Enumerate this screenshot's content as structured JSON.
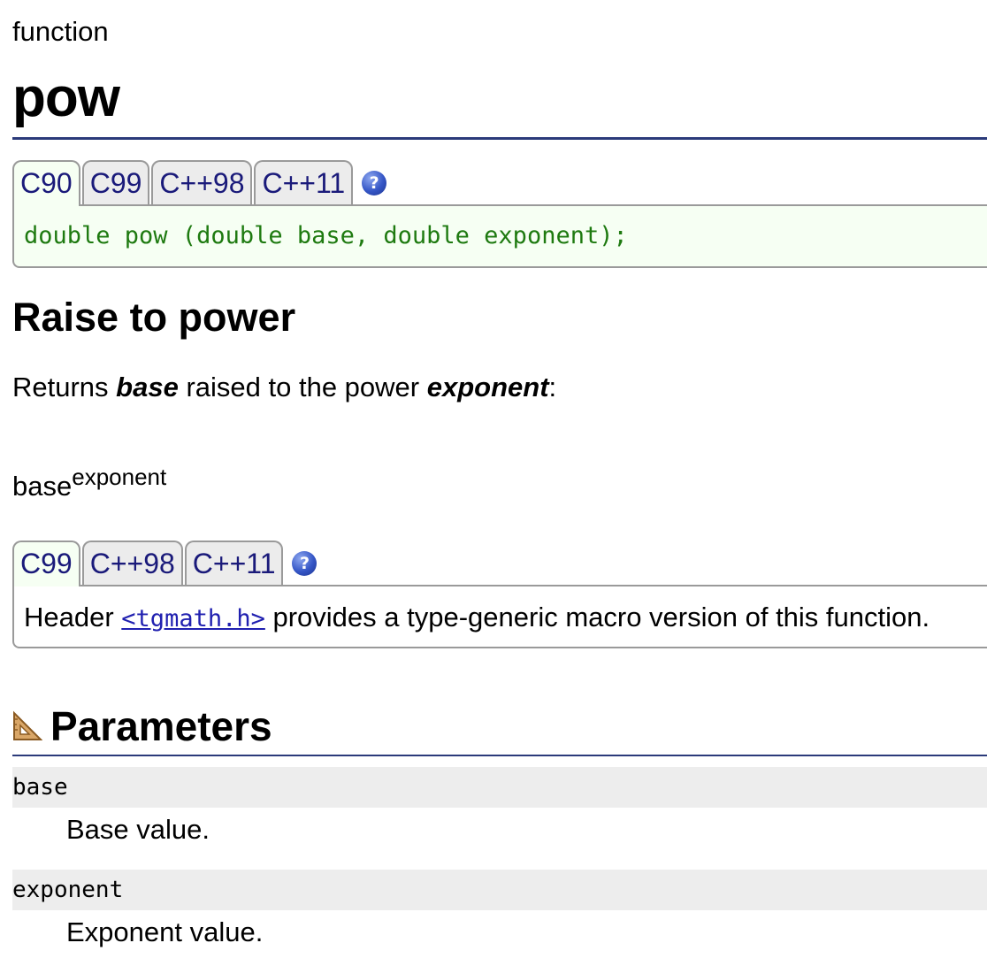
{
  "header": {
    "kind": "function",
    "title": "pow"
  },
  "prototype_box": {
    "tabs": [
      "C90",
      "C99",
      "C++98",
      "C++11"
    ],
    "active_tab": "C90",
    "help_icon": "question-icon",
    "code": "double pow (double base, double exponent);"
  },
  "description": {
    "heading": "Raise to power",
    "text_before": "Returns ",
    "base_term": "base",
    "text_middle": " raised to the power ",
    "exponent_term": "exponent",
    "text_after": ":",
    "formula_base": "base",
    "formula_exponent": "exponent"
  },
  "note_box": {
    "tabs": [
      "C99",
      "C++98",
      "C++11"
    ],
    "active_tab": "C99",
    "help_icon": "question-icon",
    "text_before": "Header ",
    "link": "<tgmath.h>",
    "text_after": " provides a type-generic macro version of this function."
  },
  "parameters": {
    "icon": "ruler-triangle-icon",
    "heading": "Parameters",
    "items": [
      {
        "name": "base",
        "description": "Base value."
      },
      {
        "name": "exponent",
        "description": "Exponent value."
      }
    ]
  },
  "colors": {
    "accent_rule": "#2b3a7a",
    "code_text": "#1e7a10",
    "tab_text": "#1a1a7a",
    "link": "#2020b0"
  }
}
